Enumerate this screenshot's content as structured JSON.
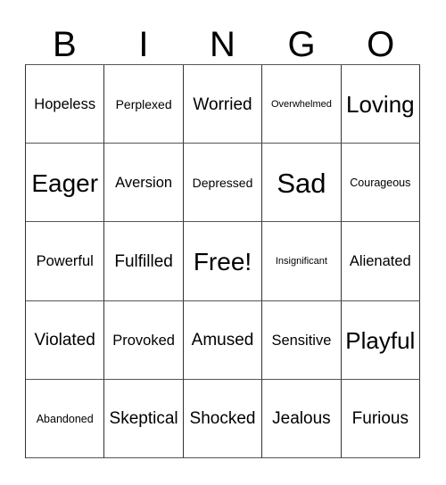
{
  "card": {
    "title": "BINGO",
    "header_letters": [
      "B",
      "I",
      "N",
      "G",
      "O"
    ],
    "columns": 5,
    "rows": 5,
    "border_color": "#333333",
    "background_color": "#ffffff",
    "text_color": "#000000"
  },
  "grid": {
    "rows": [
      {
        "cells": [
          {
            "label": "Hopeless",
            "size": "m"
          },
          {
            "label": "Perplexed",
            "size": "sm"
          },
          {
            "label": "Worried",
            "size": "ml"
          },
          {
            "label": "Overwhelmed",
            "size": "xs"
          },
          {
            "label": "Loving",
            "size": "xl"
          }
        ]
      },
      {
        "cells": [
          {
            "label": "Eager",
            "size": "xxl"
          },
          {
            "label": "Aversion",
            "size": "m"
          },
          {
            "label": "Depressed",
            "size": "sm"
          },
          {
            "label": "Sad",
            "size": "huge"
          },
          {
            "label": "Courageous",
            "size": "s"
          }
        ]
      },
      {
        "cells": [
          {
            "label": "Powerful",
            "size": "m"
          },
          {
            "label": "Fulfilled",
            "size": "ml"
          },
          {
            "label": "Free!",
            "size": "xxl"
          },
          {
            "label": "Insignificant",
            "size": "xs"
          },
          {
            "label": "Alienated",
            "size": "m"
          }
        ]
      },
      {
        "cells": [
          {
            "label": "Violated",
            "size": "ml"
          },
          {
            "label": "Provoked",
            "size": "m"
          },
          {
            "label": "Amused",
            "size": "ml"
          },
          {
            "label": "Sensitive",
            "size": "m"
          },
          {
            "label": "Playful",
            "size": "xl"
          }
        ]
      },
      {
        "cells": [
          {
            "label": "Abandoned",
            "size": "s"
          },
          {
            "label": "Skeptical",
            "size": "ml"
          },
          {
            "label": "Shocked",
            "size": "ml"
          },
          {
            "label": "Jealous",
            "size": "ml"
          },
          {
            "label": "Furious",
            "size": "ml"
          }
        ]
      }
    ]
  }
}
